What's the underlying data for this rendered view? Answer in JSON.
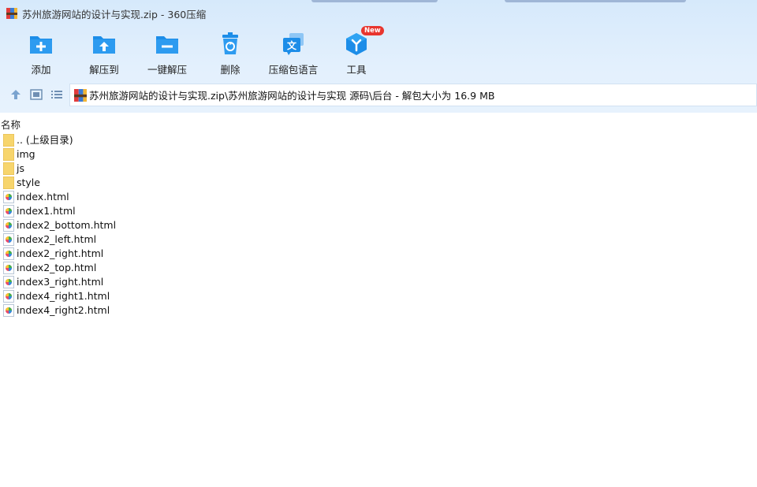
{
  "window": {
    "title": "苏州旅游网站的设计与实现.zip - 360压缩",
    "app_icon": "archive-icon"
  },
  "toolbar": {
    "items": [
      {
        "label": "添加",
        "icon": "add-folder-icon"
      },
      {
        "label": "解压到",
        "icon": "extract-to-icon"
      },
      {
        "label": "一键解压",
        "icon": "one-click-extract-icon"
      },
      {
        "label": "删除",
        "icon": "delete-icon"
      },
      {
        "label": "压缩包语言",
        "icon": "language-icon"
      },
      {
        "label": "工具",
        "icon": "tools-icon",
        "badge": "New"
      }
    ]
  },
  "nav": {
    "up_icon": "up-arrow-icon",
    "view_icon": "thumbnail-view-icon",
    "list_icon": "list-view-icon"
  },
  "address": {
    "path": "苏州旅游网站的设计与实现.zip\\苏州旅游网站的设计与实现  源码\\后台 - 解包大小为 16.9 MB"
  },
  "columns": {
    "name": "名称"
  },
  "files": [
    {
      "name": ".. (上级目录)",
      "type": "folder"
    },
    {
      "name": "img",
      "type": "folder"
    },
    {
      "name": "js",
      "type": "folder"
    },
    {
      "name": "style",
      "type": "folder"
    },
    {
      "name": "index.html",
      "type": "html"
    },
    {
      "name": "index1.html",
      "type": "html"
    },
    {
      "name": "index2_bottom.html",
      "type": "html"
    },
    {
      "name": "index2_left.html",
      "type": "html"
    },
    {
      "name": "index2_right.html",
      "type": "html"
    },
    {
      "name": "index2_top.html",
      "type": "html"
    },
    {
      "name": "index3_right.html",
      "type": "html"
    },
    {
      "name": "index4_right1.html",
      "type": "html"
    },
    {
      "name": "index4_right2.html",
      "type": "html"
    }
  ],
  "colors": {
    "toolbar_bg": "#d6e9fb",
    "icon_blue": "#1c8de8",
    "folder_yellow": "#f7d56d",
    "badge_red": "#e8352e"
  }
}
